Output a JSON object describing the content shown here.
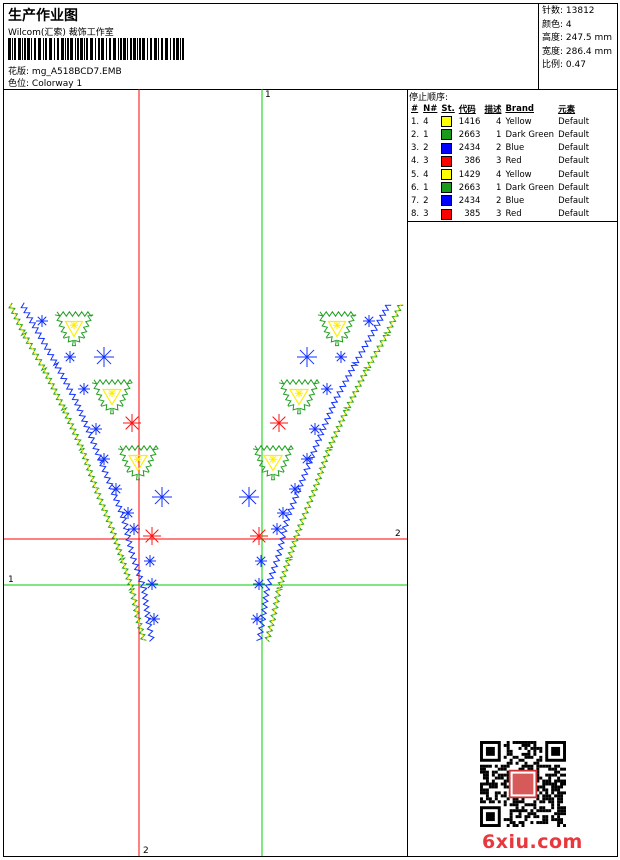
{
  "header": {
    "title": "生产作业图",
    "company": "Wilcom(汇索) 裁饰工作室",
    "design_label": "花版:",
    "design_value": "mg_A518BCD7.EMB",
    "colorway_label": "色位:",
    "colorway_value": "Colorway 1"
  },
  "stats": {
    "stitches": "针数: 13812",
    "colors": "颜色: 4",
    "height": "高度: 247.5 mm",
    "width": "宽度: 286.4 mm",
    "scale": "比例: 0.47"
  },
  "stop_sequence": {
    "title": "停止顺序:",
    "headers": [
      "#",
      "N#",
      "St.",
      "代码",
      "描述",
      "Brand",
      "元素"
    ],
    "rows": [
      {
        "idx": "1.",
        "n": "4",
        "color": "#ffff00",
        "st": "1416",
        "code": "4",
        "desc": "Yellow",
        "brand": "Default"
      },
      {
        "idx": "2.",
        "n": "1",
        "color": "#1a9c1a",
        "st": "2663",
        "code": "1",
        "desc": "Dark Green",
        "brand": "Default"
      },
      {
        "idx": "3.",
        "n": "2",
        "color": "#0000ff",
        "st": "2434",
        "code": "2",
        "desc": "Blue",
        "brand": "Default"
      },
      {
        "idx": "4.",
        "n": "3",
        "color": "#ff0000",
        "st": "386",
        "code": "3",
        "desc": "Red",
        "brand": "Default"
      },
      {
        "idx": "5.",
        "n": "4",
        "color": "#ffff00",
        "st": "1429",
        "code": "4",
        "desc": "Yellow",
        "brand": "Default"
      },
      {
        "idx": "6.",
        "n": "1",
        "color": "#1a9c1a",
        "st": "2663",
        "code": "1",
        "desc": "Dark Green",
        "brand": "Default"
      },
      {
        "idx": "7.",
        "n": "2",
        "color": "#0000ff",
        "st": "2434",
        "code": "2",
        "desc": "Blue",
        "brand": "Default"
      },
      {
        "idx": "8.",
        "n": "3",
        "color": "#ff0000",
        "st": "385",
        "code": "3",
        "desc": "Red",
        "brand": "Default"
      }
    ]
  },
  "axes": {
    "label_1": "1",
    "label_2": "2"
  },
  "watermark": "6xiu.com",
  "qr_stamp": "印章"
}
